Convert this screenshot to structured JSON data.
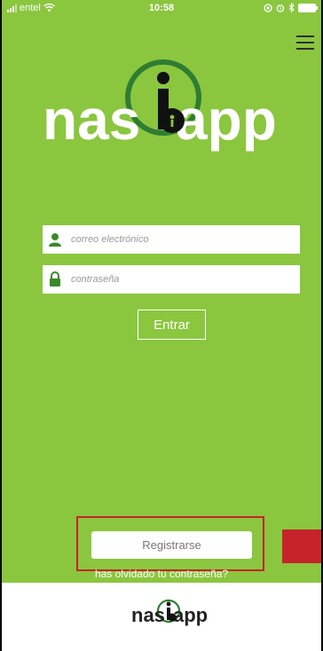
{
  "status_bar": {
    "carrier": "entel",
    "time": "10:58"
  },
  "logo": {
    "text_left": "nas",
    "text_right": "app"
  },
  "login": {
    "email_placeholder": "correo electrónico",
    "password_placeholder": "contraseña",
    "submit_label": "Entrar"
  },
  "register": {
    "button_label": "Registrarse",
    "forgot_link": "has olvidado tu contraseña?"
  },
  "footer": {
    "logo_text_left": "nas",
    "logo_text_right": "app"
  },
  "colors": {
    "background": "#8bc63f",
    "accent_dark_green": "#2e7d32",
    "highlight_red": "#c6232a"
  }
}
